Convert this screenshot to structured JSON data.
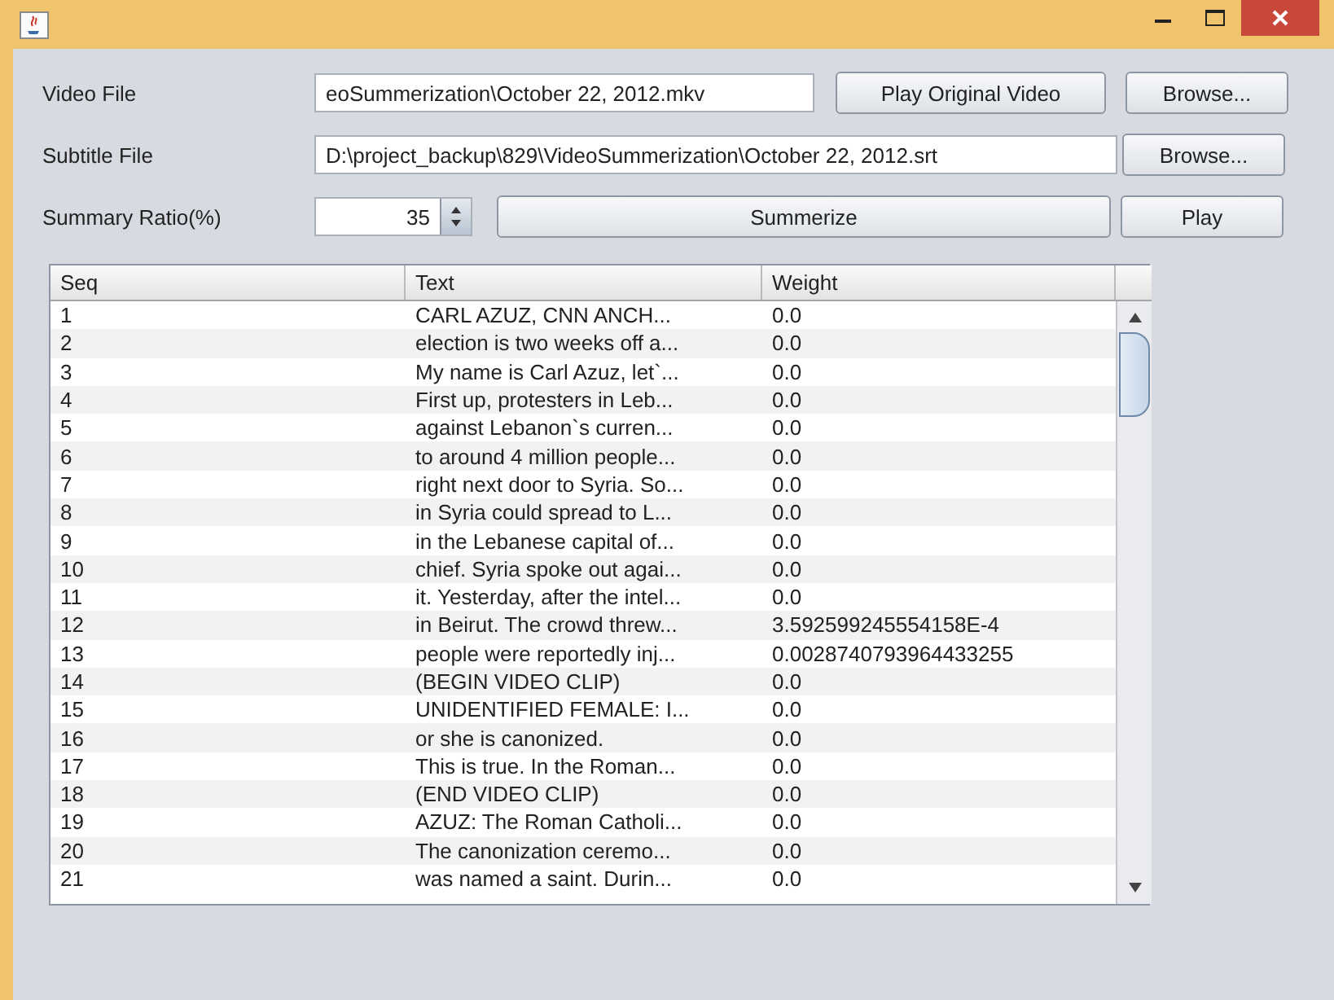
{
  "form": [
    {
      "kind": "file",
      "label": "Video File",
      "value": "eoSummerization\\October 22, 2012.mkv",
      "buttons": [
        "Play Original Video",
        "Browse..."
      ]
    },
    {
      "kind": "file",
      "label": "Subtitle File",
      "value": "D:\\project_backup\\829\\VideoSummerization\\October 22, 2012.srt",
      "buttons": [
        "Browse..."
      ]
    },
    {
      "kind": "spinner",
      "label": "Summary Ratio(%)",
      "value": "35",
      "buttons": [
        "Summerize",
        "Play"
      ]
    }
  ],
  "table": {
    "columns": [
      "Seq",
      "Text",
      "Weight"
    ],
    "rows": [
      [
        "1",
        "CARL AZUZ, CNN ANCH...",
        "0.0"
      ],
      [
        "2",
        "election is two weeks off a...",
        "0.0"
      ],
      [
        "3",
        "My name is Carl Azuz, let`...",
        "0.0"
      ],
      [
        "4",
        "First up, protesters in Leb...",
        "0.0"
      ],
      [
        "5",
        "against Lebanon`s curren...",
        "0.0"
      ],
      [
        "6",
        "to around 4 million people...",
        "0.0"
      ],
      [
        "7",
        "right next door to Syria. So...",
        "0.0"
      ],
      [
        "8",
        "in Syria could spread to L...",
        "0.0"
      ],
      [
        "9",
        "in the Lebanese capital of...",
        "0.0"
      ],
      [
        "10",
        "chief. Syria spoke out agai...",
        "0.0"
      ],
      [
        "11",
        "it. Yesterday, after the intel...",
        "0.0"
      ],
      [
        "12",
        "in Beirut. The crowd threw...",
        "3.592599245554158E-4"
      ],
      [
        "13",
        "people were reportedly inj...",
        "0.0028740793964433255"
      ],
      [
        "14",
        "(BEGIN VIDEO CLIP)",
        "0.0"
      ],
      [
        "15",
        "UNIDENTIFIED FEMALE: I...",
        "0.0"
      ],
      [
        "16",
        "or she is canonized.",
        "0.0"
      ],
      [
        "17",
        "This is true. In the Roman...",
        "0.0"
      ],
      [
        "18",
        "(END VIDEO CLIP)",
        "0.0"
      ],
      [
        "19",
        "AZUZ: The Roman Catholi...",
        "0.0"
      ],
      [
        "20",
        "The canonization ceremo...",
        "0.0"
      ],
      [
        "21",
        "was named a saint. Durin...",
        "0.0"
      ]
    ]
  }
}
